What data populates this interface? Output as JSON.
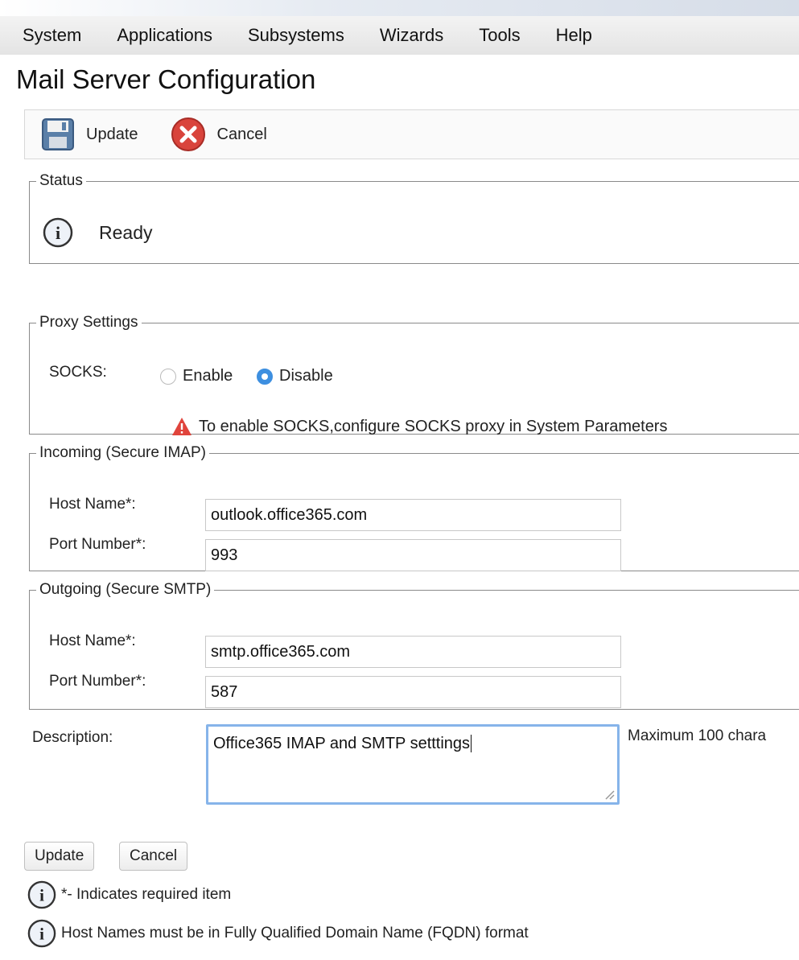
{
  "menu": [
    "System",
    "Applications",
    "Subsystems",
    "Wizards",
    "Tools",
    "Help"
  ],
  "page_title": "Mail Server Configuration",
  "toolbar": {
    "update_label": "Update",
    "cancel_label": "Cancel"
  },
  "status": {
    "legend": "Status",
    "text": "Ready"
  },
  "proxy": {
    "legend": "Proxy Settings",
    "socks_label": "SOCKS:",
    "enable_label": "Enable",
    "disable_label": "Disable",
    "selected": "Disable",
    "warning": "To enable SOCKS,configure SOCKS proxy in System Parameters"
  },
  "incoming": {
    "legend": "Incoming (Secure IMAP)",
    "host_label": "Host Name*:",
    "host_value": "outlook.office365.com",
    "port_label": "Port Number*:",
    "port_value": "993"
  },
  "outgoing": {
    "legend": "Outgoing (Secure SMTP)",
    "host_label": "Host Name*:",
    "host_value": "smtp.office365.com",
    "port_label": "Port Number*:",
    "port_value": "587"
  },
  "description": {
    "label": "Description:",
    "value": "Office365 IMAP and SMTP setttings",
    "hint": "Maximum 100 chara"
  },
  "buttons": {
    "update": "Update",
    "cancel": "Cancel"
  },
  "notes": [
    "*- Indicates required item",
    "Host Names must be in Fully Qualified Domain Name (FQDN) format"
  ],
  "colors": {
    "accent": "#3d8fe0",
    "warning": "#e0443c",
    "cancel_icon": "#d9443c"
  },
  "icons": {
    "update": "floppy-disk-icon",
    "cancel": "cancel-x-icon",
    "info": "info-icon",
    "warning": "warning-triangle-icon"
  }
}
